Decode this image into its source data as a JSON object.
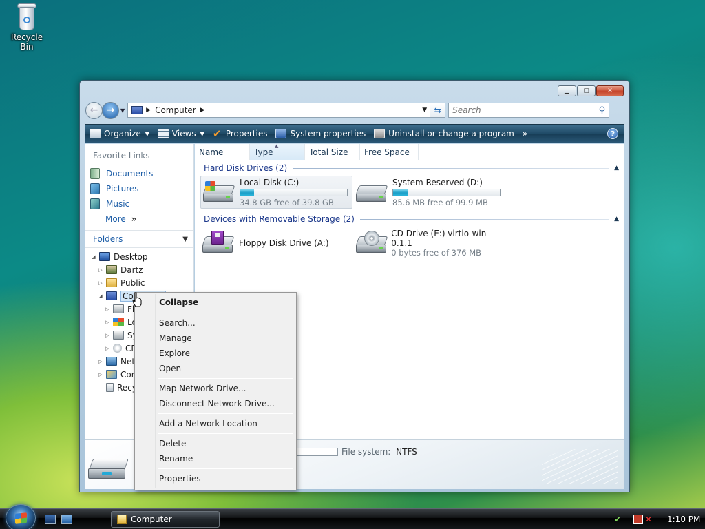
{
  "desktop": {
    "recycle_bin_label": "Recycle Bin"
  },
  "window": {
    "title": "Computer",
    "address": {
      "crumb": "Computer"
    },
    "search_placeholder": "Search",
    "toolbar": {
      "organize": "Organize",
      "views": "Views",
      "properties": "Properties",
      "system_properties": "System properties",
      "uninstall": "Uninstall or change a program",
      "more": "»"
    },
    "nav_pane": {
      "favorite_links_title": "Favorite Links",
      "favorites": [
        {
          "label": "Documents",
          "icon": "documents-icon"
        },
        {
          "label": "Pictures",
          "icon": "pictures-icon"
        },
        {
          "label": "Music",
          "icon": "music-icon"
        }
      ],
      "more_label": "More",
      "more_glyph": "»",
      "folders_title": "Folders",
      "tree": [
        {
          "label": "Desktop",
          "icon": "desktop-icon",
          "expander": "◢"
        },
        {
          "label": "Dartz",
          "icon": "user-folder-icon",
          "expander": "▷"
        },
        {
          "label": "Public",
          "icon": "public-folder-icon",
          "expander": "▷"
        },
        {
          "label": "Computer",
          "icon": "computer-icon",
          "expander": "◢"
        },
        {
          "label": "Fl",
          "icon": "floppy-icon",
          "expander": "▷"
        },
        {
          "label": "Lo",
          "icon": "windows-drive-icon",
          "expander": "▷"
        },
        {
          "label": "Sy",
          "icon": "drive-icon",
          "expander": "▷"
        },
        {
          "label": "CD",
          "icon": "cd-drive-icon",
          "expander": "▷"
        },
        {
          "label": "Netw",
          "icon": "network-icon",
          "expander": "▷"
        },
        {
          "label": "Con",
          "icon": "control-panel-icon",
          "expander": "▷"
        },
        {
          "label": "Recy",
          "icon": "recycle-bin-icon",
          "expander": ""
        }
      ]
    },
    "columns": [
      "Name",
      "Type",
      "Total Size",
      "Free Space"
    ],
    "groups": {
      "hard_disks": {
        "title": "Hard Disk Drives (2)",
        "drives": [
          {
            "name": "Local Disk (C:)",
            "free_text": "34.8 GB free of 39.8 GB",
            "used_fraction": 0.13
          },
          {
            "name": "System Reserved (D:)",
            "free_text": "85.6 MB free of 99.9 MB",
            "used_fraction": 0.14
          }
        ]
      },
      "removable": {
        "title": "Devices with Removable Storage (2)",
        "devices": [
          {
            "name": "Floppy Disk Drive (A:)"
          },
          {
            "name": "CD Drive (E:) virtio-win-0.1.1",
            "free_text": "0 bytes free of 376 MB"
          }
        ]
      }
    },
    "details": {
      "file_system_label": "File system:",
      "file_system_value": "NTFS"
    }
  },
  "context_menu": {
    "items": [
      {
        "label": "Collapse",
        "bold": true
      },
      {
        "label": "Search..."
      },
      {
        "label": "Manage"
      },
      {
        "label": "Explore"
      },
      {
        "label": "Open"
      },
      {
        "label": "Map Network Drive..."
      },
      {
        "label": "Disconnect Network Drive..."
      },
      {
        "label": "Add a Network Location"
      },
      {
        "label": "Delete"
      },
      {
        "label": "Rename"
      },
      {
        "label": "Properties"
      }
    ]
  },
  "taskbar": {
    "window_button": "Computer",
    "clock": "1:10 PM"
  }
}
